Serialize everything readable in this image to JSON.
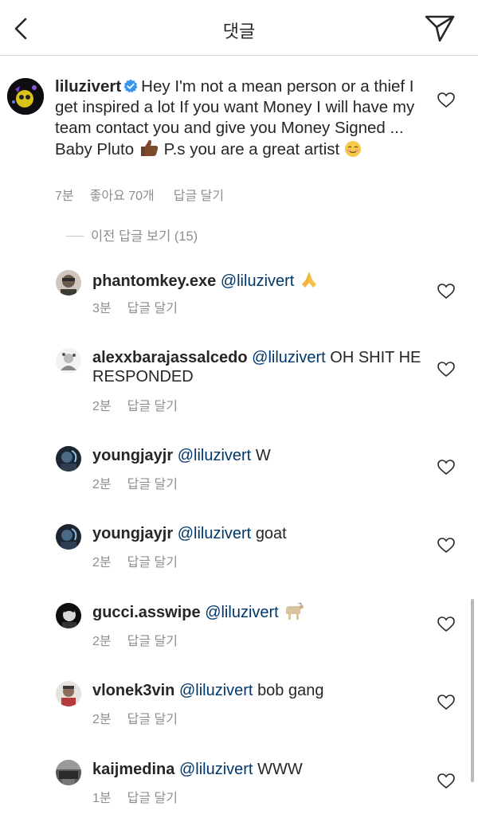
{
  "header": {
    "title": "댓글",
    "back_icon": "chevron-left-icon",
    "share_icon": "paper-plane-icon"
  },
  "main_comment": {
    "username": "liluzivert",
    "text_part1": "Hey I'm not a mean person or a thief I get inspired a lot If you want Money I will have my team contact you and give you Money Signed ... Baby Pluto",
    "text_part2": "P.s you are a great artist",
    "time": "7분",
    "likes": "좋아요 70개",
    "reply_label": "답글 달기"
  },
  "view_replies": "이전 답글 보기 (15)",
  "replies": [
    {
      "username": "phantomkey.exe",
      "mention": "@liluzivert",
      "text": "",
      "emoji": "folded-hands",
      "time": "3분",
      "reply_label": "답글 달기"
    },
    {
      "username": "alexxbarajassalcedo",
      "mention": "@liluzivert",
      "text": "OH SHIT HE RESPONDED",
      "emoji": "",
      "time": "2분",
      "reply_label": "답글 달기"
    },
    {
      "username": "youngjayjr",
      "mention": "@liluzivert",
      "text": "W",
      "emoji": "",
      "time": "2분",
      "reply_label": "답글 달기"
    },
    {
      "username": "youngjayjr",
      "mention": "@liluzivert",
      "text": "goat",
      "emoji": "",
      "time": "2분",
      "reply_label": "답글 달기"
    },
    {
      "username": "gucci.asswipe",
      "mention": "@liluzivert",
      "text": "",
      "emoji": "goat",
      "time": "2분",
      "reply_label": "답글 달기"
    },
    {
      "username": "vlonek3vin",
      "mention": "@liluzivert",
      "text": "bob gang",
      "emoji": "",
      "time": "2분",
      "reply_label": "답글 달기"
    },
    {
      "username": "kaijmedina",
      "mention": "@liluzivert",
      "text": "WWW",
      "emoji": "",
      "time": "1분",
      "reply_label": "답글 달기"
    }
  ],
  "colors": {
    "text": "#262626",
    "meta": "#8e8e8e",
    "mention": "#00376b",
    "verified": "#3897f0",
    "divider": "#dbdbdb"
  }
}
